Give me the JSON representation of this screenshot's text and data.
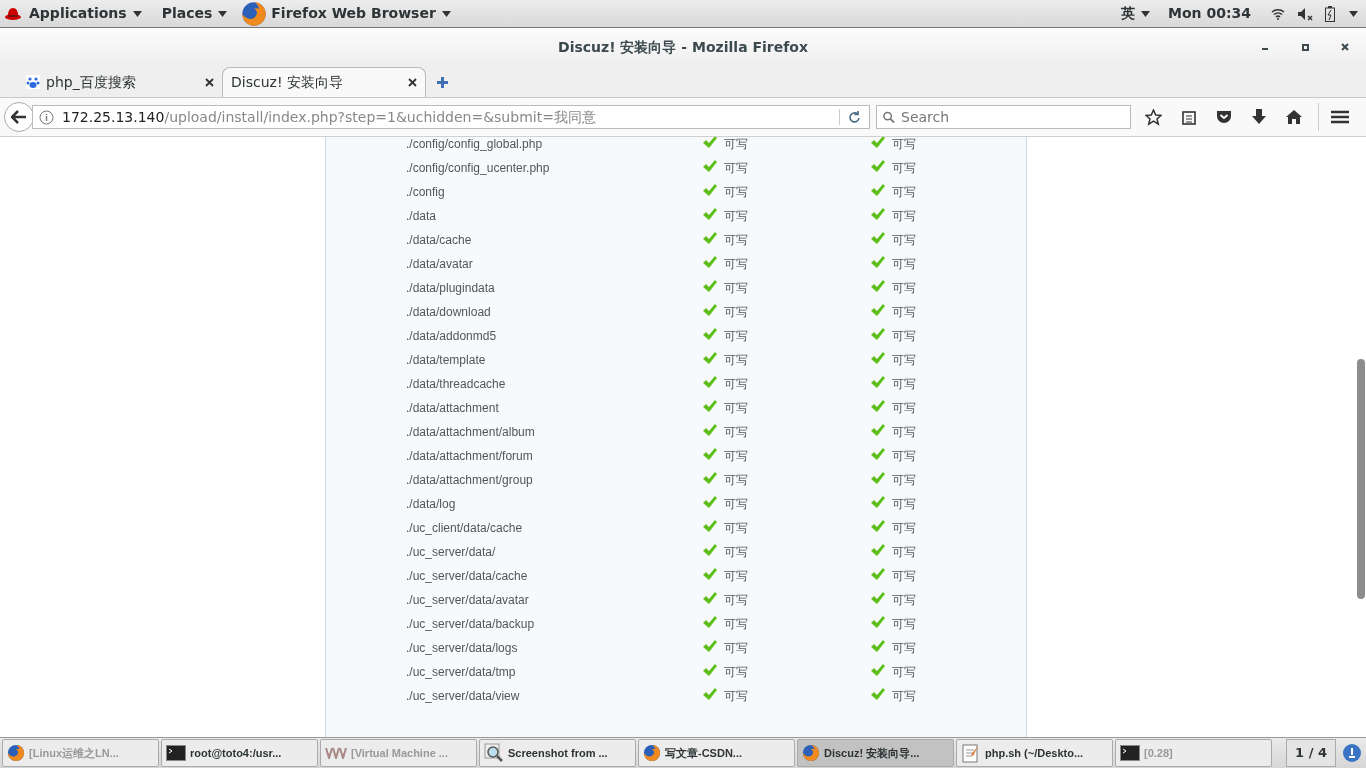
{
  "top_bar": {
    "applications": "Applications",
    "places": "Places",
    "app_menu": "Firefox Web Browser",
    "input_method": "英",
    "clock": "Mon 00:34"
  },
  "window": {
    "title": "Discuz! 安装向导 - Mozilla Firefox"
  },
  "tabs": [
    {
      "label": "php_百度搜索",
      "kind": "paw",
      "selected": false
    },
    {
      "label": "Discuz! 安装向导",
      "kind": "plain",
      "selected": true
    }
  ],
  "address": {
    "host": "172.25.13.140",
    "path": "/upload/install/index.php?step=1&uchidden=&submit=我同意"
  },
  "search": {
    "placeholder": "Search"
  },
  "rows": [
    {
      "path": "./config/config_global.php",
      "current": {
        "ok": true,
        "text": "可写"
      },
      "required": {
        "ok": true,
        "text": "可写"
      }
    },
    {
      "path": "./config/config_ucenter.php",
      "current": {
        "ok": true,
        "text": "可写"
      },
      "required": {
        "ok": true,
        "text": "可写"
      }
    },
    {
      "path": "./config",
      "current": {
        "ok": true,
        "text": "可写"
      },
      "required": {
        "ok": true,
        "text": "可写"
      }
    },
    {
      "path": "./data",
      "current": {
        "ok": true,
        "text": "可写"
      },
      "required": {
        "ok": true,
        "text": "可写"
      }
    },
    {
      "path": "./data/cache",
      "current": {
        "ok": true,
        "text": "可写"
      },
      "required": {
        "ok": true,
        "text": "可写"
      }
    },
    {
      "path": "./data/avatar",
      "current": {
        "ok": true,
        "text": "可写"
      },
      "required": {
        "ok": true,
        "text": "可写"
      }
    },
    {
      "path": "./data/plugindata",
      "current": {
        "ok": true,
        "text": "可写"
      },
      "required": {
        "ok": true,
        "text": "可写"
      }
    },
    {
      "path": "./data/download",
      "current": {
        "ok": true,
        "text": "可写"
      },
      "required": {
        "ok": true,
        "text": "可写"
      }
    },
    {
      "path": "./data/addonmd5",
      "current": {
        "ok": true,
        "text": "可写"
      },
      "required": {
        "ok": true,
        "text": "可写"
      }
    },
    {
      "path": "./data/template",
      "current": {
        "ok": true,
        "text": "可写"
      },
      "required": {
        "ok": true,
        "text": "可写"
      }
    },
    {
      "path": "./data/threadcache",
      "current": {
        "ok": true,
        "text": "可写"
      },
      "required": {
        "ok": true,
        "text": "可写"
      }
    },
    {
      "path": "./data/attachment",
      "current": {
        "ok": true,
        "text": "可写"
      },
      "required": {
        "ok": true,
        "text": "可写"
      }
    },
    {
      "path": "./data/attachment/album",
      "current": {
        "ok": true,
        "text": "可写"
      },
      "required": {
        "ok": true,
        "text": "可写"
      }
    },
    {
      "path": "./data/attachment/forum",
      "current": {
        "ok": true,
        "text": "可写"
      },
      "required": {
        "ok": true,
        "text": "可写"
      }
    },
    {
      "path": "./data/attachment/group",
      "current": {
        "ok": true,
        "text": "可写"
      },
      "required": {
        "ok": true,
        "text": "可写"
      }
    },
    {
      "path": "./data/log",
      "current": {
        "ok": true,
        "text": "可写"
      },
      "required": {
        "ok": true,
        "text": "可写"
      }
    },
    {
      "path": "./uc_client/data/cache",
      "current": {
        "ok": true,
        "text": "可写"
      },
      "required": {
        "ok": true,
        "text": "可写"
      }
    },
    {
      "path": "./uc_server/data/",
      "current": {
        "ok": true,
        "text": "可写"
      },
      "required": {
        "ok": true,
        "text": "可写"
      }
    },
    {
      "path": "./uc_server/data/cache",
      "current": {
        "ok": true,
        "text": "可写"
      },
      "required": {
        "ok": true,
        "text": "可写"
      }
    },
    {
      "path": "./uc_server/data/avatar",
      "current": {
        "ok": true,
        "text": "可写"
      },
      "required": {
        "ok": true,
        "text": "可写"
      }
    },
    {
      "path": "./uc_server/data/backup",
      "current": {
        "ok": true,
        "text": "可写"
      },
      "required": {
        "ok": true,
        "text": "可写"
      }
    },
    {
      "path": "./uc_server/data/logs",
      "current": {
        "ok": true,
        "text": "可写"
      },
      "required": {
        "ok": true,
        "text": "可写"
      }
    },
    {
      "path": "./uc_server/data/tmp",
      "current": {
        "ok": true,
        "text": "可写"
      },
      "required": {
        "ok": true,
        "text": "可写"
      }
    },
    {
      "path": "./uc_server/data/view",
      "current": {
        "ok": true,
        "text": "可写"
      },
      "required": {
        "ok": true,
        "text": "可写"
      }
    }
  ],
  "taskbar": {
    "items": [
      {
        "label": "[Linux运维之LN...",
        "kind": "firefox",
        "minimized": true,
        "selected": false
      },
      {
        "label": "root@toto4:/usr...",
        "kind": "terminal",
        "minimized": false,
        "selected": false
      },
      {
        "label": "[Virtual Machine ...",
        "kind": "vm",
        "minimized": true,
        "selected": false
      },
      {
        "label": "Screenshot from ...",
        "kind": "screenshot",
        "minimized": false,
        "selected": false
      },
      {
        "label": "写文章-CSDN...",
        "kind": "firefox",
        "minimized": false,
        "selected": false
      },
      {
        "label": "Discuz! 安装向导...",
        "kind": "firefox",
        "minimized": false,
        "selected": true
      },
      {
        "label": "php.sh (~/Deskto...",
        "kind": "editor",
        "minimized": false,
        "selected": false
      },
      {
        "label": "[0.28]",
        "kind": "terminal",
        "minimized": true,
        "selected": false
      }
    ],
    "workspace": "1 / 4"
  }
}
